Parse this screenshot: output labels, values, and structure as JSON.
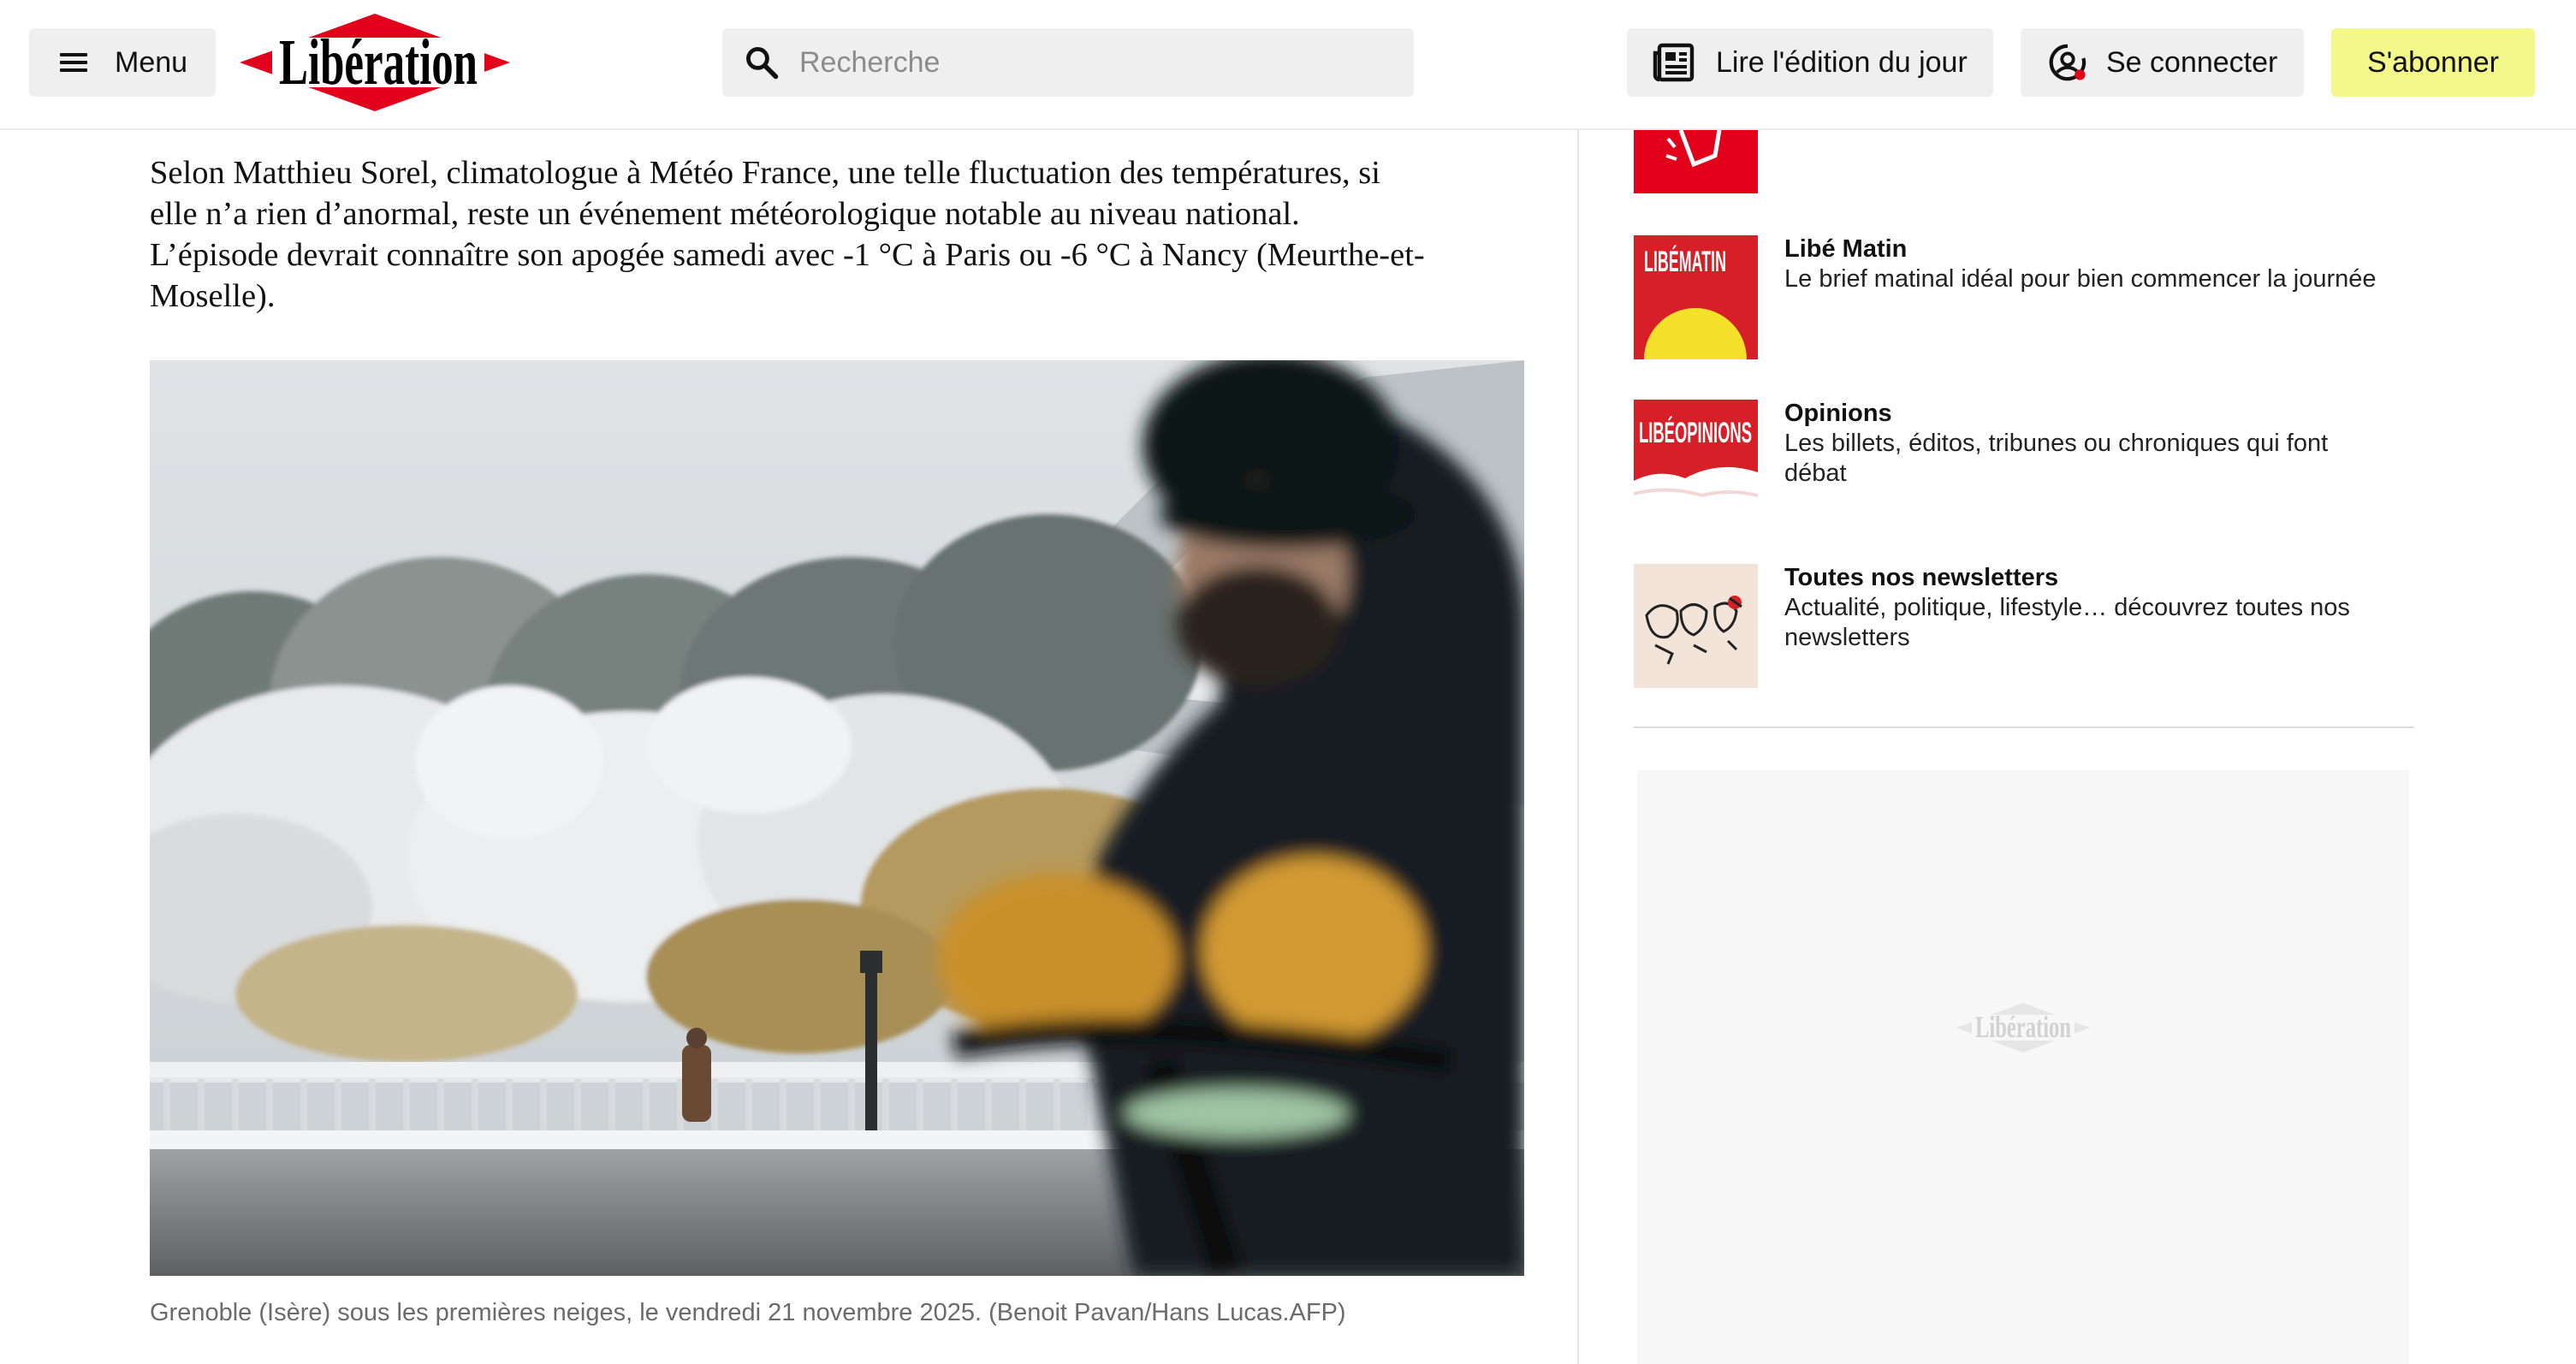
{
  "header": {
    "menu_label": "Menu",
    "logo_text": "Libération",
    "search_placeholder": "Recherche",
    "edition_label": "Lire l'édition du jour",
    "connect_label": "Se connecter",
    "subscribe_label": "S'abonner",
    "colors": {
      "brand_red": "#e3001b",
      "subscribe_bg": "#f4f78a"
    }
  },
  "article": {
    "paragraph_lines": [
      "Selon Matthieu Sorel, climatologue à Météo France, une telle fluctuation des températures, si",
      "elle n’a rien d’anormal, reste un événement météorologique notable au niveau national.",
      "L’épisode devrait connaître son apogée samedi avec -1 °C à Paris ou -6 °C à Nancy (Meurthe-et-",
      "Moselle)."
    ],
    "image_caption": "Grenoble (Isère) sous les premières neiges, le vendredi 21 novembre 2025. (Benoit Pavan/Hans Lucas.AFP)"
  },
  "sidebar": {
    "newsletters": [
      {
        "title": "Libé Matin",
        "description": "Le brief matinal idéal pour bien commencer la journée",
        "thumb_text": "LIBÉMATIN"
      },
      {
        "title": "Opinions",
        "description_lines": [
          "Les billets, éditos, tribunes ou chroniques qui font",
          "débat"
        ],
        "thumb_text": "LIBÉOPINIONS"
      },
      {
        "title": "Toutes nos newsletters",
        "description_lines": [
          "Actualité, politique, lifestyle… découvrez toutes nos",
          "newsletters"
        ]
      }
    ],
    "ad_logo_text": "Libération"
  }
}
